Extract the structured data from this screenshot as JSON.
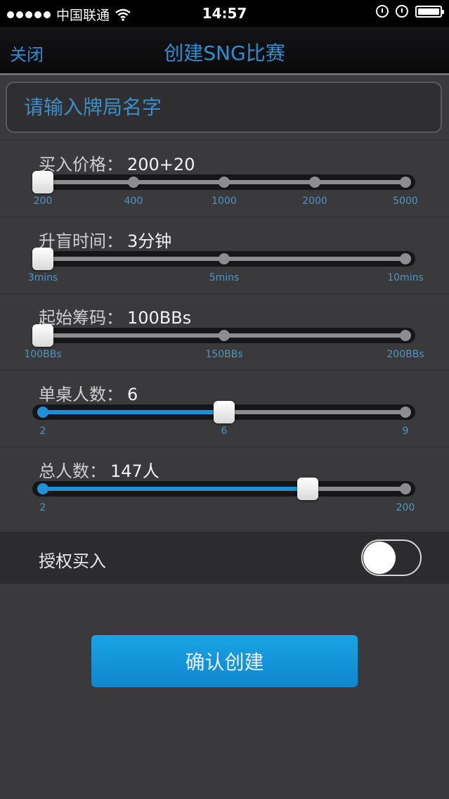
{
  "status_bar": {
    "carrier": "中国联通",
    "time": "14:57",
    "icons": [
      "signal-dots-icon",
      "wifi-icon",
      "rotation-lock-icon",
      "alarm-icon",
      "battery-icon"
    ]
  },
  "nav": {
    "close_label": "关闭",
    "title": "创建SNG比赛"
  },
  "name_field": {
    "placeholder": "请输入牌局名字",
    "value": ""
  },
  "sliders": [
    {
      "label": "买入价格：",
      "value": "200+20",
      "ticks": [
        "200",
        "400",
        "1000",
        "2000",
        "5000"
      ],
      "selected_index": 0
    },
    {
      "label": "升盲时间：",
      "value": "3分钟",
      "ticks": [
        "3mins",
        "5mins",
        "10mins"
      ],
      "selected_index": 0
    },
    {
      "label": "起始筹码：",
      "value": "100BBs",
      "ticks": [
        "100BBs",
        "150BBs",
        "200BBs"
      ],
      "selected_index": 0
    },
    {
      "label": "单桌人数：",
      "value": "6",
      "ticks": [
        "2",
        "6",
        "9"
      ],
      "selected_index": 1,
      "fill_fraction": 0.5
    },
    {
      "label": "总人数：",
      "value": "147人",
      "ticks": [
        "2",
        "200"
      ],
      "fill_fraction": 0.73
    }
  ],
  "authorize_buyin": {
    "label": "授权买入",
    "enabled": false
  },
  "confirm_button": {
    "label": "确认创建"
  },
  "colors": {
    "accent": "#1f8fd6",
    "background": "#3a3a3c",
    "nav_background": "#0a0a0b"
  }
}
